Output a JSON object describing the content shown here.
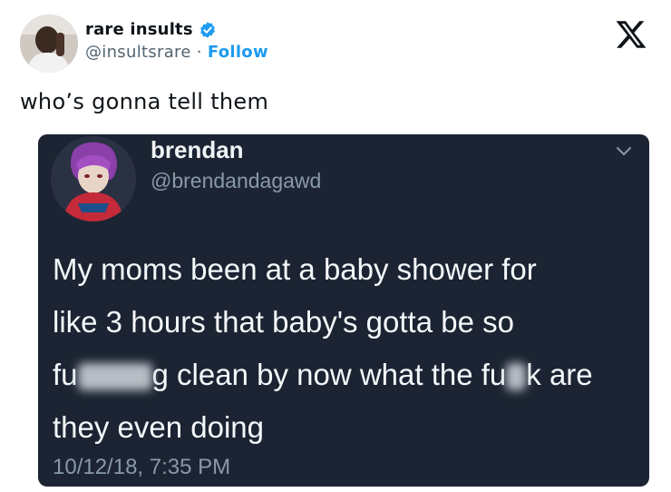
{
  "author": {
    "display_name": "rare insults",
    "handle": "@insultsrare",
    "separator": " · ",
    "follow_label": "Follow",
    "verified": true
  },
  "tweet": {
    "text": "who’s gonna tell them"
  },
  "embedded": {
    "display_name": "brendan",
    "handle": "@brendandagawd",
    "lines": {
      "l1": "My moms been at a baby shower for",
      "l2": "like 3 hours that baby's gotta be so",
      "l3_a": "fu",
      "l3_b": "g clean by now what the fu",
      "l3_c": "k are",
      "l4": "they even doing"
    },
    "timestamp": "10/12/18, 7:35 PM"
  },
  "colors": {
    "brand_blue": "#1d9bf0",
    "embed_bg": "#1c2433",
    "embed_text": "#f5f8fa",
    "embed_muted": "#8899a6"
  },
  "icons": {
    "verified": "verified-badge-icon",
    "logo": "x-logo-icon",
    "chevron": "chevron-down-icon"
  }
}
